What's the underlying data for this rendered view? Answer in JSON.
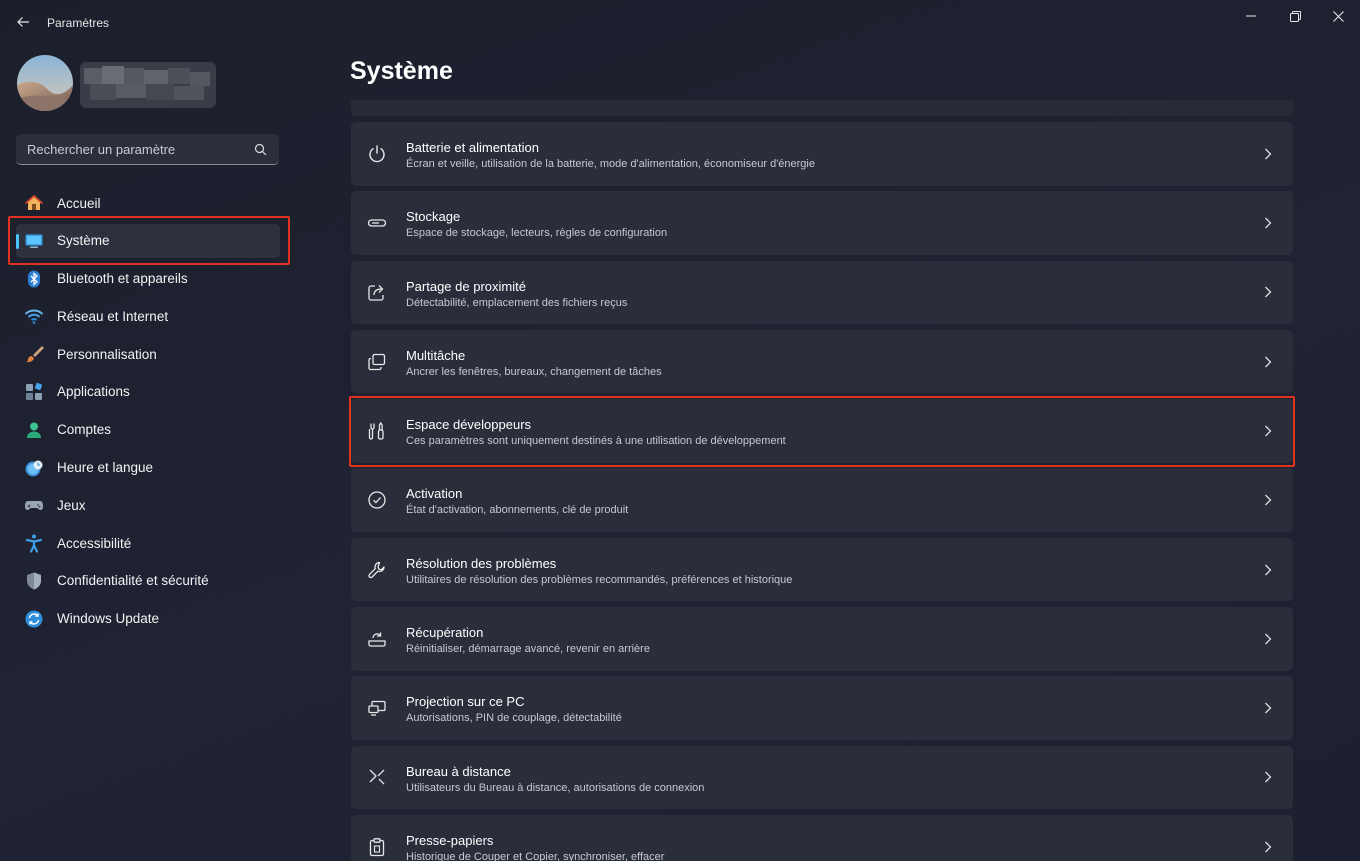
{
  "window": {
    "title": "Paramètres",
    "back_icon": "arrow-left-icon",
    "minimize_icon": "minimize-icon",
    "maximize_icon": "restore-icon",
    "close_icon": "close-icon"
  },
  "account": {
    "avatar_icon": "user-avatar-desert"
  },
  "search": {
    "placeholder": "Rechercher un paramètre",
    "value": "",
    "icon": "search-icon"
  },
  "sidebar": {
    "active_color": "#4cc2ff",
    "items": [
      {
        "label": "Accueil",
        "icon": "home-icon"
      },
      {
        "label": "Système",
        "icon": "system-display-icon",
        "active": true
      },
      {
        "label": "Bluetooth et appareils",
        "icon": "bluetooth-icon"
      },
      {
        "label": "Réseau et Internet",
        "icon": "wifi-icon"
      },
      {
        "label": "Personnalisation",
        "icon": "paintbrush-icon"
      },
      {
        "label": "Applications",
        "icon": "apps-icon"
      },
      {
        "label": "Comptes",
        "icon": "account-icon"
      },
      {
        "label": "Heure et langue",
        "icon": "clock-globe-icon"
      },
      {
        "label": "Jeux",
        "icon": "gamepad-icon"
      },
      {
        "label": "Accessibilité",
        "icon": "accessibility-icon"
      },
      {
        "label": "Confidentialité et sécurité",
        "icon": "shield-icon"
      },
      {
        "label": "Windows Update",
        "icon": "update-icon"
      }
    ]
  },
  "main": {
    "title": "Système",
    "cards": [
      {
        "title": "Batterie et alimentation",
        "subtitle": "Écran et veille, utilisation de la batterie, mode d'alimentation, économiseur d'énergie",
        "icon": "power-icon"
      },
      {
        "title": "Stockage",
        "subtitle": "Espace de stockage, lecteurs, règles de configuration",
        "icon": "storage-icon"
      },
      {
        "title": "Partage de proximité",
        "subtitle": "Détectabilité, emplacement des fichiers reçus",
        "icon": "share-icon"
      },
      {
        "title": "Multitâche",
        "subtitle": "Ancrer les fenêtres, bureaux, changement de tâches",
        "icon": "multitask-icon"
      },
      {
        "title": "Espace développeurs",
        "subtitle": "Ces paramètres sont uniquement destinés à une utilisation de développement",
        "icon": "developer-tools-icon",
        "highlighted": true
      },
      {
        "title": "Activation",
        "subtitle": "État d'activation, abonnements, clé de produit",
        "icon": "check-circle-icon"
      },
      {
        "title": "Résolution des problèmes",
        "subtitle": "Utilitaires de résolution des problèmes recommandés, préférences et historique",
        "icon": "wrench-icon"
      },
      {
        "title": "Récupération",
        "subtitle": "Réinitialiser, démarrage avancé, revenir en arrière",
        "icon": "recovery-icon"
      },
      {
        "title": "Projection sur ce PC",
        "subtitle": "Autorisations, PIN de couplage, détectabilité",
        "icon": "projection-icon"
      },
      {
        "title": "Bureau à distance",
        "subtitle": "Utilisateurs du Bureau à distance, autorisations de connexion",
        "icon": "remote-desktop-icon"
      },
      {
        "title": "Presse-papiers",
        "subtitle": "Historique de Couper et Copier, synchroniser, effacer",
        "icon": "clipboard-icon"
      }
    ]
  },
  "highlight_color": "#e0331f"
}
